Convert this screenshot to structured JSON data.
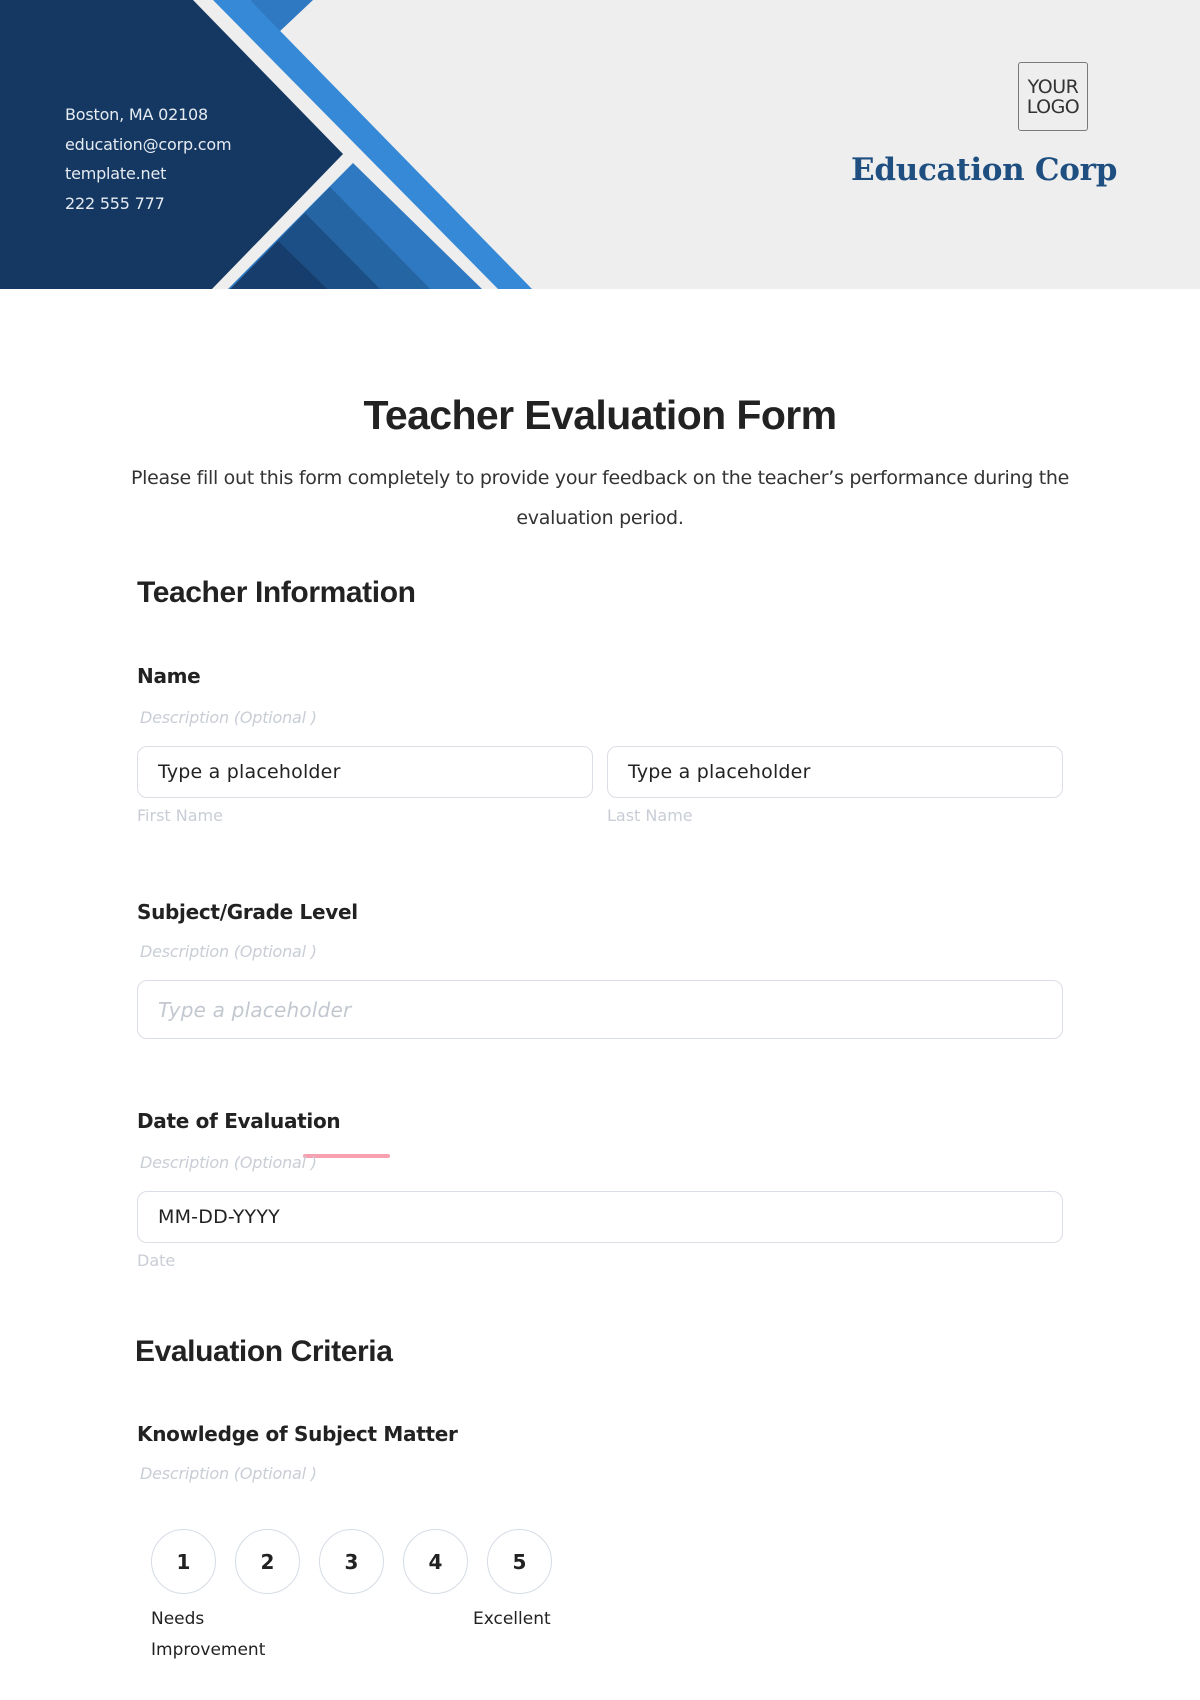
{
  "header": {
    "contact": {
      "address": "Boston, MA 02108",
      "email": "education@corp.com",
      "website": "template.net",
      "phone": "222 555 777"
    },
    "logo": {
      "line1": "YOUR",
      "line2": "LOGO"
    },
    "company_name": "Education Corp",
    "colors": {
      "navy": "#143861",
      "bright_blue": "#3689d6",
      "mid_blue": "#2f78c2",
      "band_2": "#2565a3",
      "band_3": "#1c4f85",
      "band_4": "#163d6b",
      "banner_bg": "#eeeeee",
      "brand_text": "#1f4f80"
    }
  },
  "form": {
    "title": "Teacher Evaluation Form",
    "intro": "Please fill out this form completely to provide your feedback on the teacher’s performance during the evaluation period.",
    "sections": [
      {
        "title": "Teacher Information",
        "fields": [
          {
            "label": "Name",
            "description": "Description  (Optional )",
            "inputs": [
              {
                "value": "Type a placeholder",
                "helper": "First Name"
              },
              {
                "value": "Type a placeholder",
                "helper": "Last Name"
              }
            ]
          },
          {
            "label": "Subject/Grade Level",
            "description": "Description  (Optional )",
            "inputs": [
              {
                "placeholder": "Type a placeholder"
              }
            ]
          },
          {
            "label": "Date of Evaluation",
            "description": "Description  (Optional )",
            "inputs": [
              {
                "value": "MM-DD-YYYY",
                "helper": "Date"
              }
            ]
          }
        ]
      },
      {
        "title": "Evaluation Criteria",
        "fields": [
          {
            "label": "Knowledge of Subject Matter",
            "description": "Description  (Optional )",
            "rating": {
              "options": [
                "1",
                "2",
                "3",
                "4",
                "5"
              ],
              "low_label_line1": "Needs",
              "low_label_line2": "Improvement",
              "high_label": "Excellent"
            }
          }
        ]
      }
    ]
  }
}
